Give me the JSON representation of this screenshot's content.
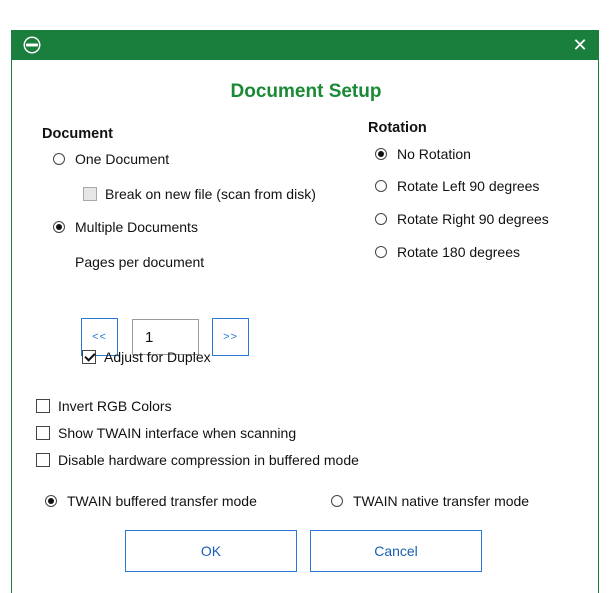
{
  "dialog": {
    "title": "Document Setup",
    "close_symbol": "✕",
    "app_icon": "app-logo-icon",
    "accent_color": "#1a7e3c",
    "title_color": "#1a8a36"
  },
  "document": {
    "heading": "Document",
    "one_document": "One Document",
    "break_on_new_file": "Break on new file (scan from disk)",
    "multiple_documents": "Multiple Documents",
    "pages_per_document_label": "Pages per document",
    "prev_label": "<<",
    "next_label": ">>",
    "pages_value": "1",
    "adjust_duplex": "Adjust for Duplex",
    "selected": "Multiple Documents",
    "break_checked": false,
    "adjust_duplex_checked": true
  },
  "rotation": {
    "heading": "Rotation",
    "options": [
      "No Rotation",
      "Rotate Left 90 degrees",
      "Rotate Right 90 degrees",
      "Rotate 180 degrees"
    ],
    "selected": "No Rotation"
  },
  "options": {
    "invert_rgb": "Invert RGB Colors",
    "show_twain": "Show TWAIN interface when scanning",
    "disable_hw_compression": "Disable hardware compression in buffered mode"
  },
  "transfer": {
    "buffered": "TWAIN buffered transfer mode",
    "native": "TWAIN native transfer mode",
    "selected": "TWAIN buffered transfer mode"
  },
  "buttons": {
    "ok": "OK",
    "cancel": "Cancel",
    "button_color": "#2a78d6"
  }
}
